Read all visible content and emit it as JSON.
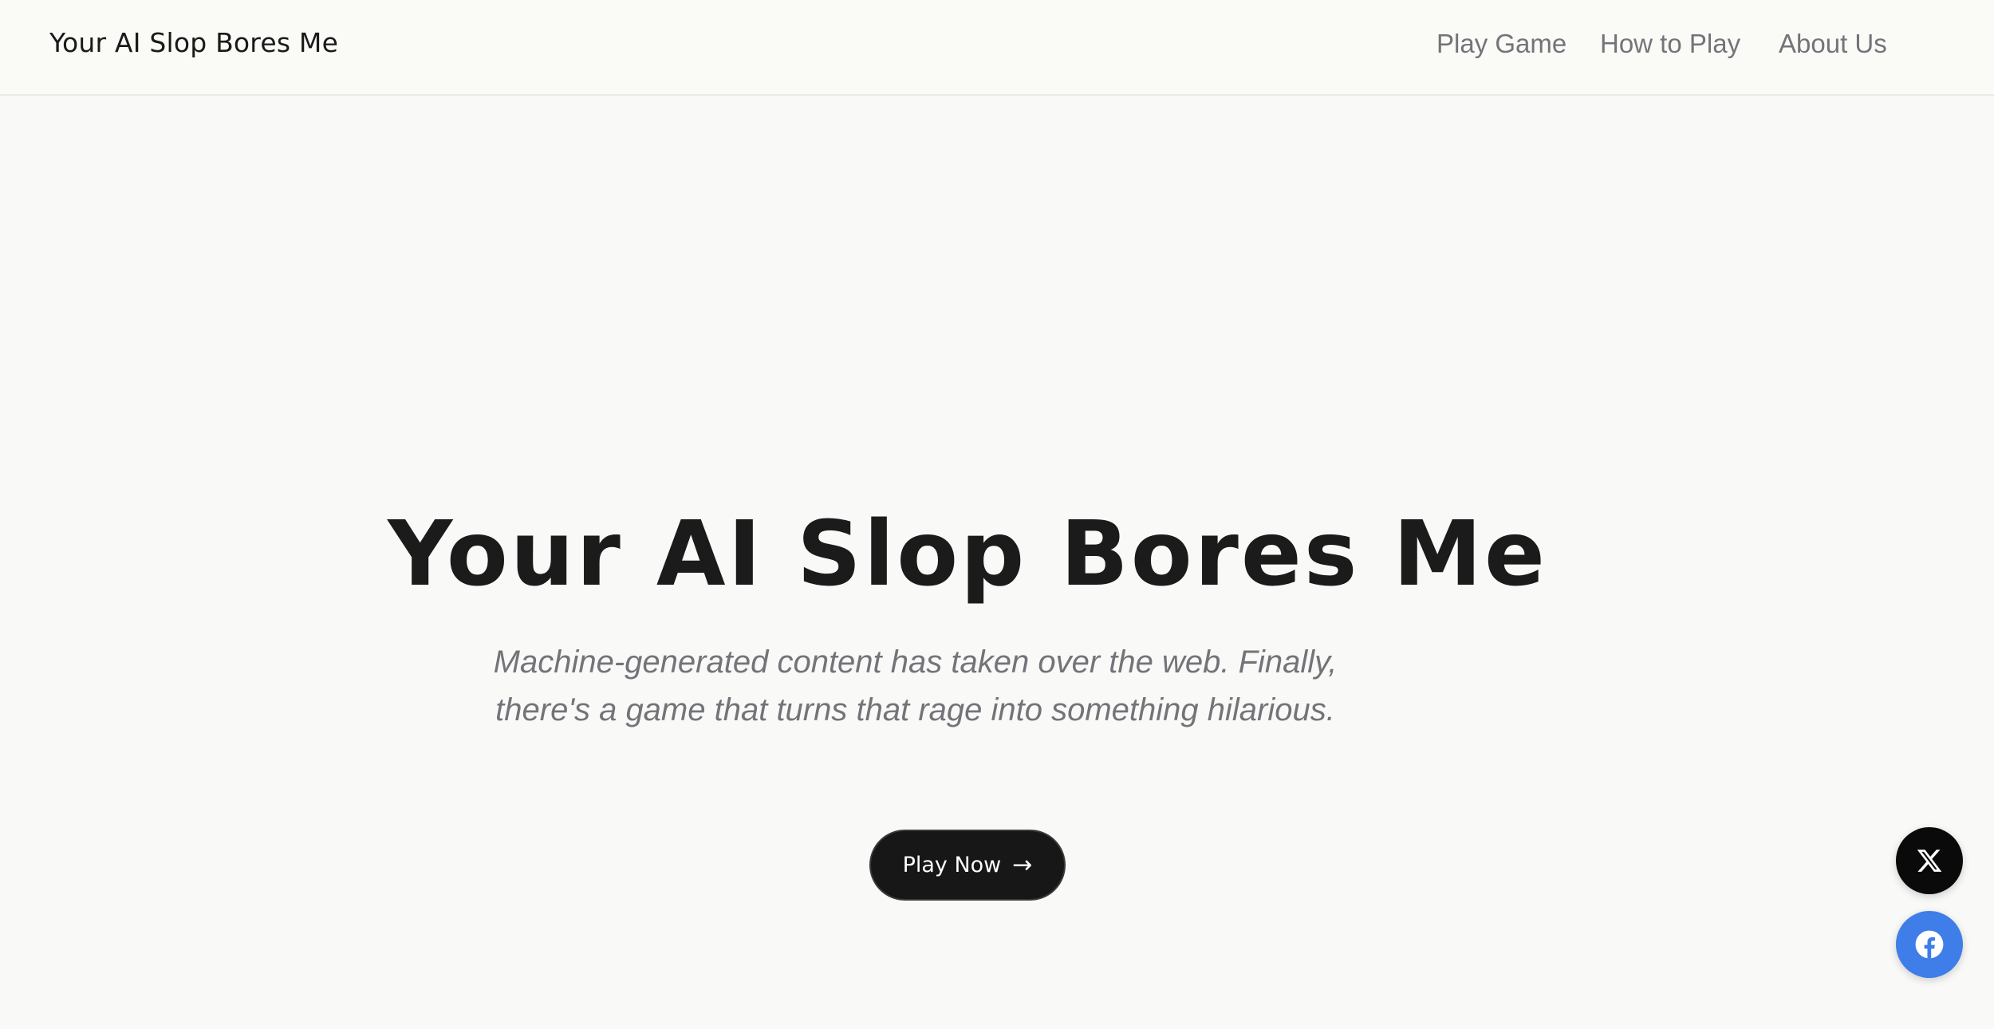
{
  "header": {
    "brand": "Your AI Slop Bores Me",
    "nav": [
      {
        "label": "Play Game"
      },
      {
        "label": "How to Play"
      },
      {
        "label": "About Us"
      }
    ]
  },
  "hero": {
    "title": "Your AI Slop Bores Me",
    "subtitle": "Machine-generated content has taken over the web. Finally, there's a game that turns that rage into something hilarious.",
    "cta_label": "Play Now",
    "cta_icon": "→"
  },
  "social": {
    "x_icon": "x-logo-icon",
    "facebook_icon": "facebook-logo-icon",
    "x_color": "#0a0a0a",
    "facebook_color": "#3f7de8"
  },
  "colors": {
    "background": "#f9f9f7",
    "text_dark": "#1b1b1b",
    "text_muted": "#737479"
  }
}
